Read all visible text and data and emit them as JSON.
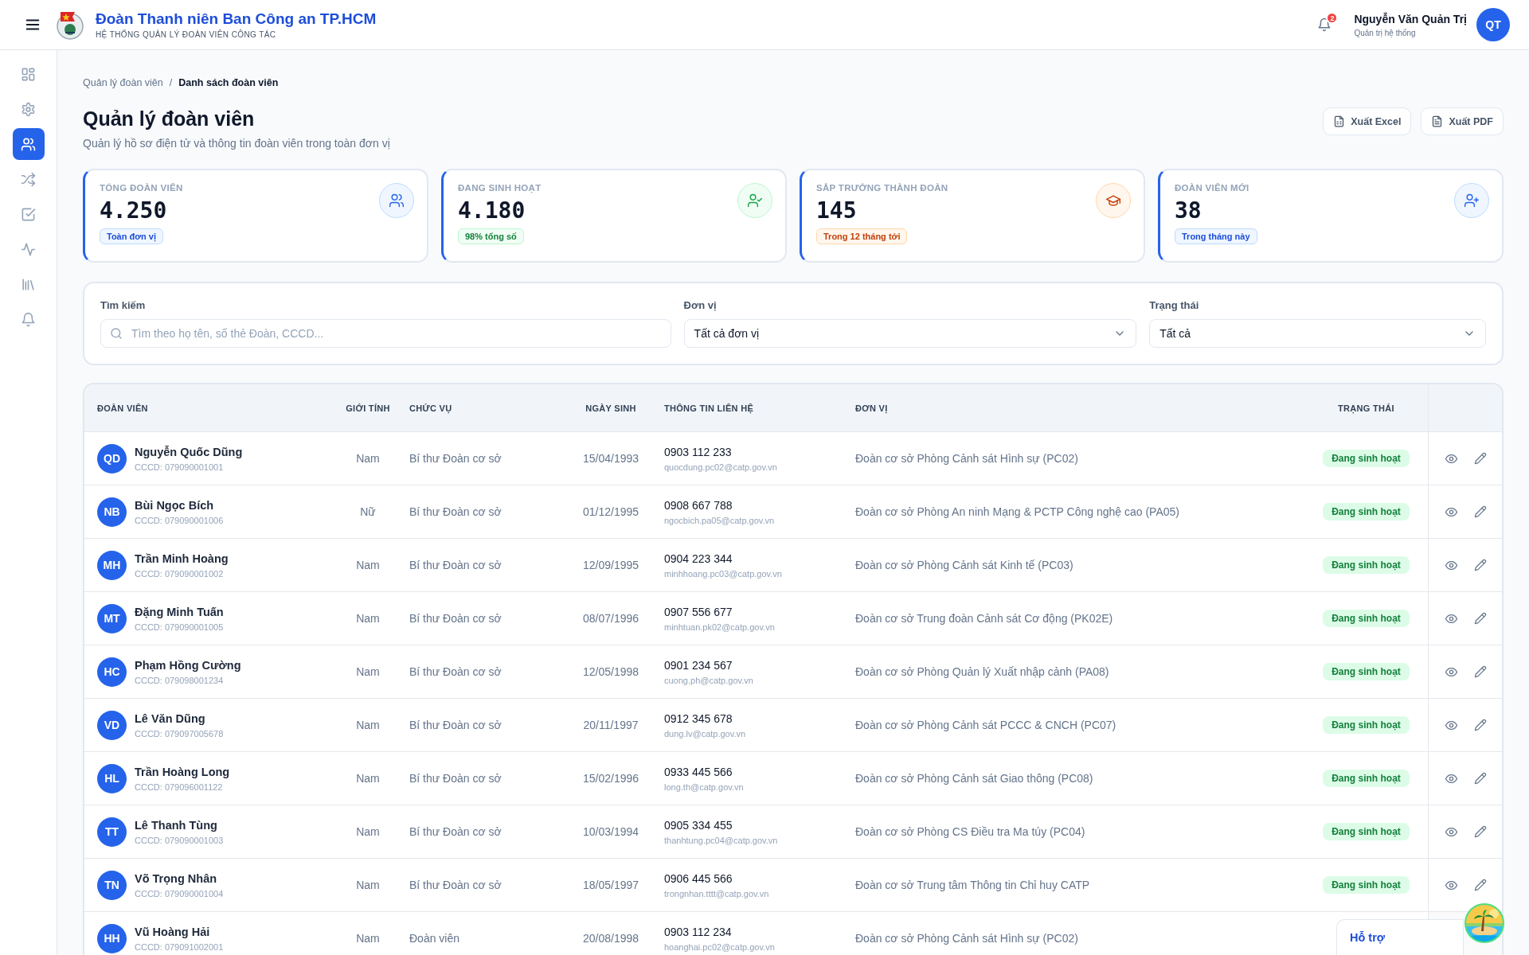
{
  "header": {
    "title": "Đoàn Thanh niên Ban Công an TP.HCM",
    "subtitle": "HỆ THỐNG QUẢN LÝ ĐOÀN VIÊN CÔNG TÁC",
    "notification_count": "2",
    "user": {
      "name": "Nguyễn Văn Quản Trị",
      "role": "Quản trị hệ thống",
      "initials": "QT"
    }
  },
  "sidebar": {
    "items": [
      {
        "kind": "dashboard",
        "selected": false
      },
      {
        "kind": "settings",
        "selected": false
      },
      {
        "kind": "members",
        "selected": true
      },
      {
        "kind": "transfer",
        "selected": false
      },
      {
        "kind": "tasks",
        "selected": false
      },
      {
        "kind": "activity",
        "selected": false
      },
      {
        "kind": "library",
        "selected": false
      },
      {
        "kind": "notifications",
        "selected": false
      }
    ]
  },
  "breadcrumb": {
    "separator": "/",
    "items": [
      {
        "label": "Quản lý đoàn viên",
        "current": false
      },
      {
        "label": "Danh sách đoàn viên",
        "current": true
      }
    ]
  },
  "page": {
    "title": "Quản lý đoàn viên",
    "subtitle": "Quản lý hồ sơ điện tử và thông tin đoàn viên trong toàn đơn vị",
    "actions": [
      {
        "kind": "excel",
        "label": "Xuất Excel"
      },
      {
        "kind": "pdf",
        "label": "Xuất PDF"
      }
    ]
  },
  "stats": [
    {
      "kind": "total",
      "label": "TỔNG ĐOÀN VIÊN",
      "value": "4.250",
      "note": "Toàn đơn vị"
    },
    {
      "kind": "active",
      "label": "ĐANG SINH HOẠT",
      "value": "4.180",
      "note": "98% tổng số"
    },
    {
      "kind": "graduating",
      "label": "SẮP TRƯỞNG THÀNH ĐOÀN",
      "value": "145",
      "note": "Trong 12 tháng tới"
    },
    {
      "kind": "new",
      "label": "ĐOÀN VIÊN MỚI",
      "value": "38",
      "note": "Trong tháng này"
    }
  ],
  "filters": {
    "search": {
      "label": "Tìm kiếm",
      "placeholder": "Tìm theo họ tên, số thẻ Đoàn, CCCD..."
    },
    "unit": {
      "label": "Đơn vị",
      "value": "Tất cả đơn vị"
    },
    "status": {
      "label": "Trạng thái",
      "value": "Tất cả"
    }
  },
  "table": {
    "columns": [
      "ĐOÀN VIÊN",
      "GIỚI TÍNH",
      "CHỨC VỤ",
      "NGÀY SINH",
      "THÔNG TIN LIÊN HỆ",
      "ĐƠN VỊ",
      "TRẠNG THÁI"
    ],
    "rows": [
      {
        "initials": "QD",
        "name": "Nguyễn Quốc Dũng",
        "cccd": "CCCD: 079090001001",
        "gender": "Nam",
        "position": "Bí thư Đoàn cơ sở",
        "dob": "15/04/1993",
        "phone": "0903 112 233",
        "email": "quocdung.pc02@catp.gov.vn",
        "unit": "Đoàn cơ sở Phòng Cảnh sát Hình sự (PC02)",
        "status": "Đang sinh hoạt",
        "actions": true
      },
      {
        "initials": "NB",
        "name": "Bùi Ngọc Bích",
        "cccd": "CCCD: 079090001006",
        "gender": "Nữ",
        "position": "Bí thư Đoàn cơ sở",
        "dob": "01/12/1995",
        "phone": "0908 667 788",
        "email": "ngocbich.pa05@catp.gov.vn",
        "unit": "Đoàn cơ sở Phòng An ninh Mạng & PCTP Công nghệ cao (PA05)",
        "status": "Đang sinh hoạt",
        "actions": true
      },
      {
        "initials": "MH",
        "name": "Trần Minh Hoàng",
        "cccd": "CCCD: 079090001002",
        "gender": "Nam",
        "position": "Bí thư Đoàn cơ sở",
        "dob": "12/09/1995",
        "phone": "0904 223 344",
        "email": "minhhoang.pc03@catp.gov.vn",
        "unit": "Đoàn cơ sở Phòng Cảnh sát Kinh tế (PC03)",
        "status": "Đang sinh hoạt",
        "actions": true
      },
      {
        "initials": "MT",
        "name": "Đặng Minh Tuấn",
        "cccd": "CCCD: 079090001005",
        "gender": "Nam",
        "position": "Bí thư Đoàn cơ sở",
        "dob": "08/07/1996",
        "phone": "0907 556 677",
        "email": "minhtuan.pk02@catp.gov.vn",
        "unit": "Đoàn cơ sở Trung đoàn Cảnh sát Cơ động (PK02E)",
        "status": "Đang sinh hoạt",
        "actions": true
      },
      {
        "initials": "HC",
        "name": "Phạm Hồng Cường",
        "cccd": "CCCD: 079098001234",
        "gender": "Nam",
        "position": "Bí thư Đoàn cơ sở",
        "dob": "12/05/1998",
        "phone": "0901 234 567",
        "email": "cuong.ph@catp.gov.vn",
        "unit": "Đoàn cơ sở Phòng Quản lý Xuất nhập cảnh (PA08)",
        "status": "Đang sinh hoạt",
        "actions": true
      },
      {
        "initials": "VD",
        "name": "Lê Văn Dũng",
        "cccd": "CCCD: 079097005678",
        "gender": "Nam",
        "position": "Bí thư Đoàn cơ sở",
        "dob": "20/11/1997",
        "phone": "0912 345 678",
        "email": "dung.lv@catp.gov.vn",
        "unit": "Đoàn cơ sở Phòng Cảnh sát PCCC & CNCH (PC07)",
        "status": "Đang sinh hoạt",
        "actions": true
      },
      {
        "initials": "HL",
        "name": "Trần Hoàng Long",
        "cccd": "CCCD: 079096001122",
        "gender": "Nam",
        "position": "Bí thư Đoàn cơ sở",
        "dob": "15/02/1996",
        "phone": "0933 445 566",
        "email": "long.th@catp.gov.vn",
        "unit": "Đoàn cơ sở Phòng Cảnh sát Giao thông (PC08)",
        "status": "Đang sinh hoạt",
        "actions": true
      },
      {
        "initials": "TT",
        "name": "Lê Thanh Tùng",
        "cccd": "CCCD: 079090001003",
        "gender": "Nam",
        "position": "Bí thư Đoàn cơ sở",
        "dob": "10/03/1994",
        "phone": "0905 334 455",
        "email": "thanhtung.pc04@catp.gov.vn",
        "unit": "Đoàn cơ sở Phòng CS Điều tra Ma túy (PC04)",
        "status": "Đang sinh hoạt",
        "actions": true
      },
      {
        "initials": "TN",
        "name": "Võ Trọng Nhân",
        "cccd": "CCCD: 079090001004",
        "gender": "Nam",
        "position": "Bí thư Đoàn cơ sở",
        "dob": "18/05/1997",
        "phone": "0906 445 566",
        "email": "trongnhan.tttt@catp.gov.vn",
        "unit": "Đoàn cơ sở Trung tâm Thông tin Chỉ huy CATP",
        "status": "Đang sinh hoạt",
        "actions": true
      },
      {
        "initials": "HH",
        "name": "Vũ Hoàng Hải",
        "cccd": "CCCD: 079091002001",
        "gender": "Nam",
        "position": "Đoàn viên",
        "dob": "20/08/1998",
        "phone": "0903 112 234",
        "email": "hoanghai.pc02@catp.gov.vn",
        "unit": "Đoàn cơ sở Phòng Cảnh sát Hình sự (PC02)",
        "actions": false
      }
    ]
  },
  "support_widget": {
    "label": "Hỗ trợ",
    "kind": "picture"
  }
}
